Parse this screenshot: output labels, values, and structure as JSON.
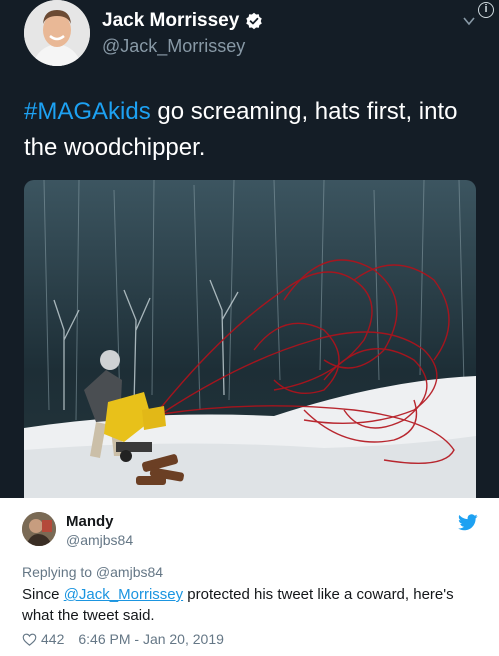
{
  "embedded_tweet": {
    "author_name": "Jack Morrissey",
    "author_handle": "@Jack_Morrissey",
    "hashtag": "#MAGAkids",
    "text_rest": " go screaming, hats first, into the woodchipper.",
    "colors": {
      "background": "#141d26",
      "hashtag": "#1da1f2",
      "handle": "#8899a6"
    },
    "icons": [
      "verified-badge-icon",
      "chevron-down-icon",
      "info-icon"
    ]
  },
  "reply_tweet": {
    "author_name": "Mandy",
    "author_handle": "@amjbs84",
    "replying_to": "Replying to @amjbs84",
    "body_prefix": "Since ",
    "mention": "@Jack_Morrissey",
    "body_suffix": " protected his tweet like a coward, here's what the tweet said.",
    "likes": "442",
    "timestamp": "6:46 PM - Jan 20, 2019",
    "colors": {
      "link": "#1b95e0",
      "muted": "#657786",
      "twitter_blue": "#1da1f2"
    },
    "icons": [
      "twitter-bird-icon",
      "heart-icon"
    ]
  }
}
